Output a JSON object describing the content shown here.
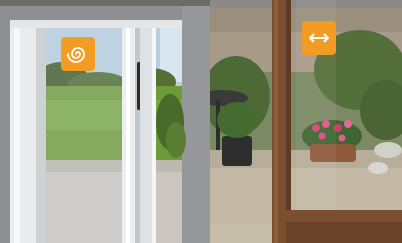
{
  "colors": {
    "badge": "#f39c23",
    "badge_icon": "#ffffff",
    "frame_gray": "#9a9b9d",
    "wood_frame": "#7a4e2f"
  },
  "icons": {
    "left_badge": "spiral-icon",
    "right_badge": "bidirectional-arrow-icon"
  }
}
